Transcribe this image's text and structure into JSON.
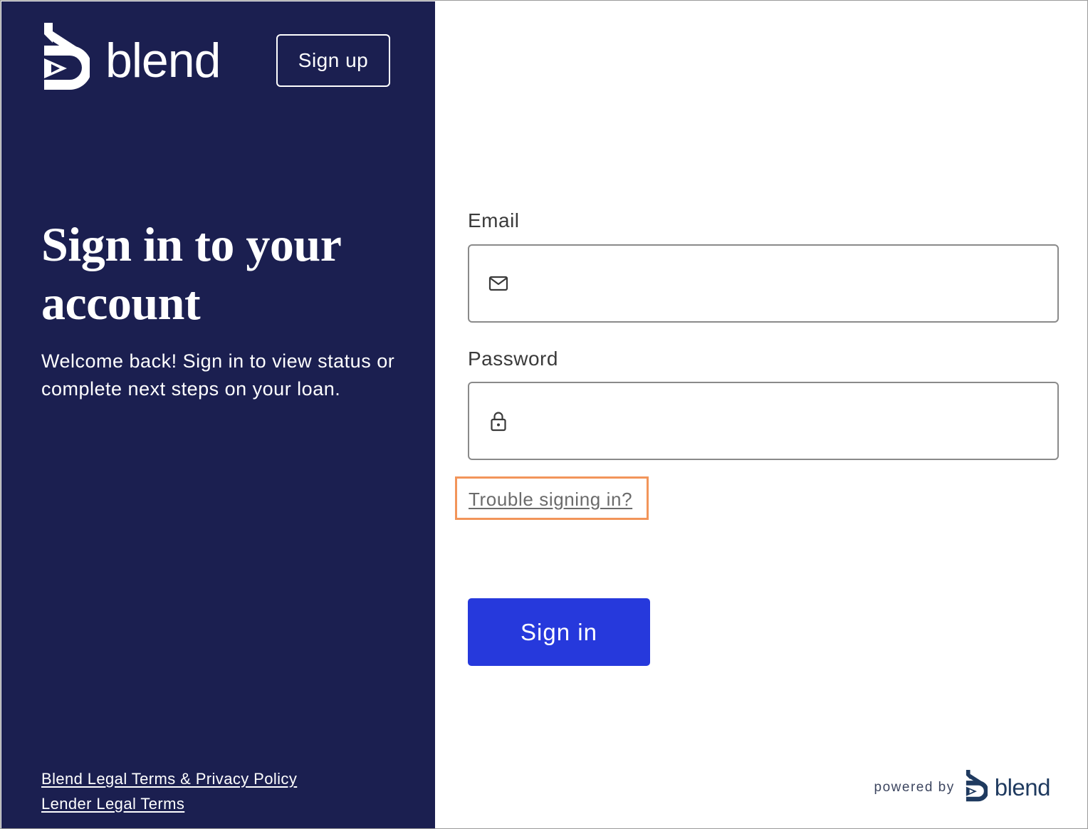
{
  "brand": {
    "name": "blend",
    "signup_label": "Sign up"
  },
  "hero": {
    "title": "Sign in to your account",
    "subtitle": "Welcome back! Sign in to view status or complete next steps on your loan."
  },
  "legal": {
    "links": [
      "Blend Legal Terms & Privacy Policy",
      "Lender Legal Terms"
    ]
  },
  "form": {
    "email_label": "Email",
    "email_value": "",
    "email_icon": "mail-icon",
    "password_label": "Password",
    "password_value": "",
    "password_icon": "lock-icon",
    "trouble_link": "Trouble signing in?",
    "submit_label": "Sign in"
  },
  "footer": {
    "powered_by": "powered by",
    "brand": "blend"
  },
  "colors": {
    "sidebar_bg": "#1b1f50",
    "primary_button": "#2639dc",
    "highlight_border": "#f2955a"
  }
}
